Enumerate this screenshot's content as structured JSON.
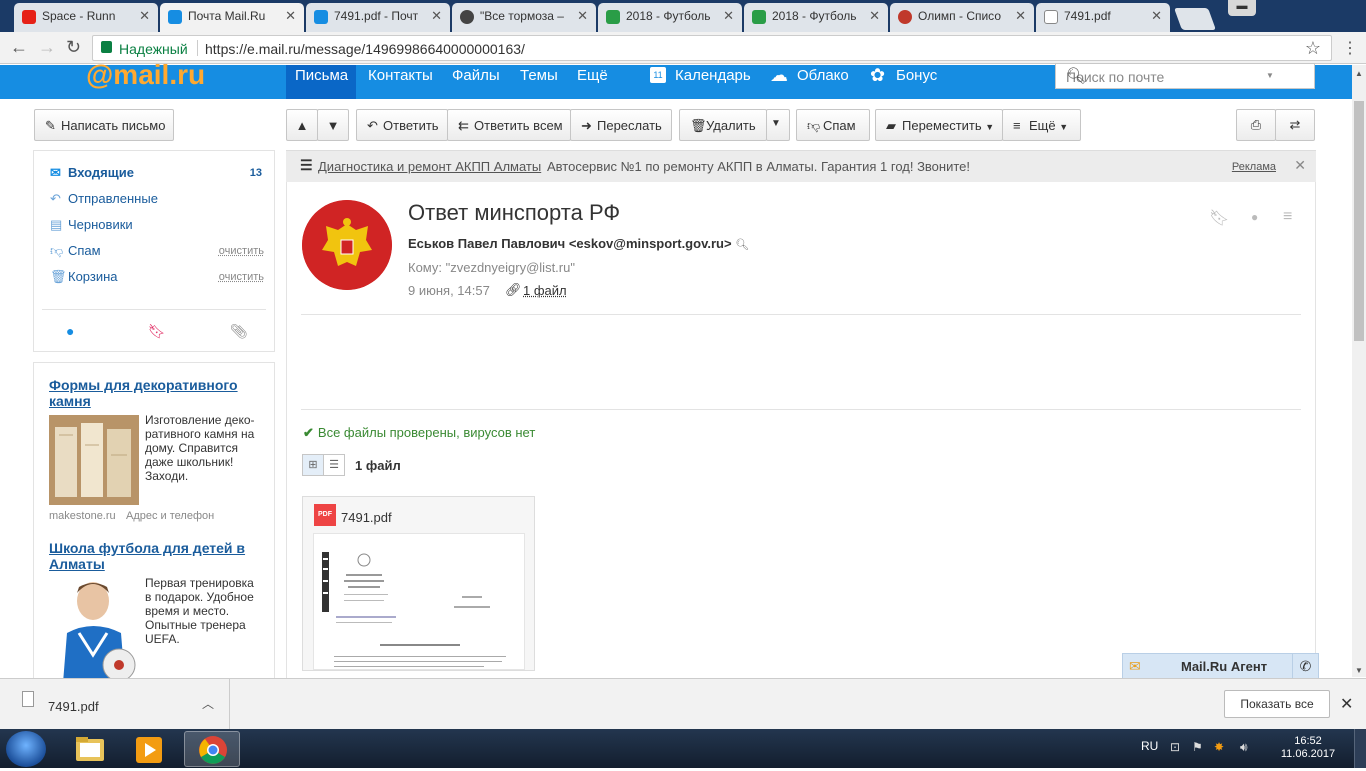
{
  "browser": {
    "tabs": [
      {
        "label": "Space - Runn",
        "icon_color": "#e62117"
      },
      {
        "label": "Почта Mail.Ru",
        "icon_color": "#168de2"
      },
      {
        "label": "7491.pdf - Почт",
        "icon_color": "#168de2"
      },
      {
        "label": "\"Все тормоза –",
        "icon_color": "#444444"
      },
      {
        "label": "2018 - Футболь",
        "icon_color": "#2a9d47"
      },
      {
        "label": "2018 - Футболь",
        "icon_color": "#2a9d47"
      },
      {
        "label": "Олимп - Списо",
        "icon_color": "#c0392b"
      },
      {
        "label": "7491.pdf",
        "icon_color": "#888888"
      }
    ],
    "secure_label": "Надежный",
    "url": "https://e.mail.ru/message/14969986640000000163/"
  },
  "header": {
    "logo": "@mail.ru",
    "nav": [
      "Письма",
      "Контакты",
      "Файлы",
      "Темы",
      "Ещё"
    ],
    "nav2": [
      "Календарь",
      "Облако",
      "Бонус"
    ],
    "calendar_day": "11",
    "search_placeholder": "Поиск по почте"
  },
  "toolbar": {
    "compose": "Написать письмо",
    "reply": "Ответить",
    "reply_all": "Ответить всем",
    "forward": "Переслать",
    "delete": "Удалить",
    "spam": "Спам",
    "move": "Переместить",
    "more": "Ещё"
  },
  "folders": [
    {
      "label": "Входящие",
      "count": "13"
    },
    {
      "label": "Отправленные"
    },
    {
      "label": "Черновики"
    },
    {
      "label": "Спам",
      "action": "очистить"
    },
    {
      "label": "Корзина",
      "action": "очистить"
    }
  ],
  "ads": [
    {
      "title": "Формы для декоративного камня",
      "text": "Изготовление деко-ративного камня на дому. Справится даже школьник! Заходи.",
      "source": "makestone.ru",
      "contact": "Адрес и телефон"
    },
    {
      "title": "Школа футбола для детей в Алматы",
      "text": "Первая тренировка в подарок. Удобное время и место. Опытные тренера UEFA."
    }
  ],
  "banner": {
    "link": "Диагностика и ремонт АКПП Алматы",
    "text": "Автосервис №1 по ремонту АКПП в Алматы. Гарантия 1 год! Звоните!",
    "ad_label": "Реклама"
  },
  "message": {
    "subject": "Ответ минспорта РФ",
    "from": "Еськов Павел Павлович <eskov@minsport.gov.ru>",
    "to": "Кому: \"zvezdnyeigry@list.ru\"",
    "date": "9 июня, 14:57",
    "attachments_link": "1 файл",
    "virus_check": "Все файлы проверены, вирусов нет",
    "files_count": "1 файл",
    "file": {
      "name": "7491.pdf",
      "type": "PDF"
    }
  },
  "agent": {
    "label": "Mail.Ru Агент"
  },
  "downloads": {
    "file": "7491.pdf",
    "show_all": "Показать все"
  },
  "taskbar": {
    "lang": "RU",
    "time": "16:52",
    "date": "11.06.2017"
  }
}
